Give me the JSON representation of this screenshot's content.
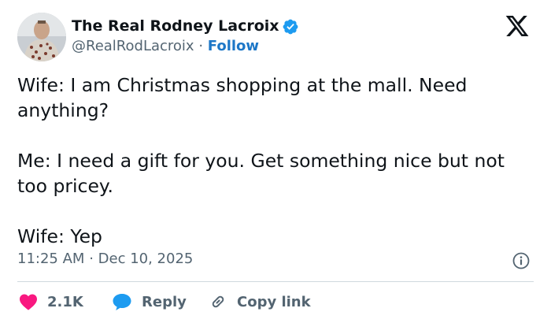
{
  "author": {
    "display_name": "The Real Rodney Lacroix",
    "handle": "@RealRodLacroix",
    "separator": "·",
    "follow_label": "Follow",
    "verified": true
  },
  "tweet": {
    "paragraphs": [
      "Wife: I am Christmas shopping at the mall. Need anything?",
      "Me: I need a gift for you. Get something nice but not too pricey.",
      "Wife: Yep"
    ],
    "time": "11:25 AM",
    "date": "Dec 10, 2025",
    "meta_separator": "·"
  },
  "actions": {
    "like_count": "2.1K",
    "reply_label": "Reply",
    "copy_link_label": "Copy link"
  },
  "colors": {
    "verified": "#1d9bf0",
    "like": "#f91880",
    "reply": "#1d9bf0",
    "follow": "#1d77c7"
  },
  "icons": [
    "x-logo-icon",
    "verified-badge-icon",
    "info-icon",
    "heart-icon",
    "reply-bubble-icon",
    "link-icon"
  ]
}
